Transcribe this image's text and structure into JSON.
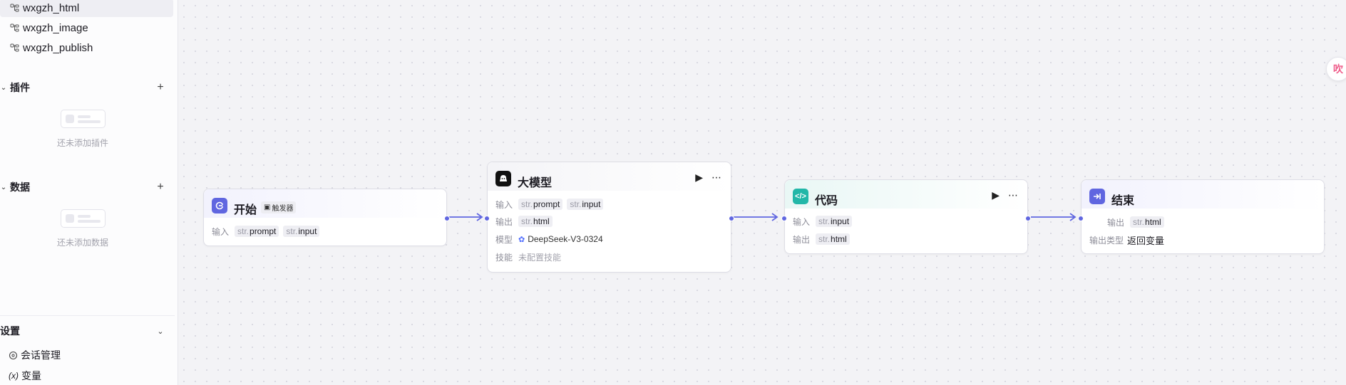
{
  "sidebar": {
    "workflows": [
      {
        "label": "wxgzh_html",
        "active": true
      },
      {
        "label": "wxgzh_image",
        "active": false
      },
      {
        "label": "wxgzh_publish",
        "active": false
      }
    ],
    "plugins": {
      "title": "插件",
      "empty_text": "还未添加插件"
    },
    "data": {
      "title": "数据",
      "empty_text": "还未添加数据"
    },
    "settings": {
      "title": "设置",
      "items": [
        {
          "label": "会话管理",
          "icon": "chat-manage-icon"
        },
        {
          "label": "变量",
          "icon": "variable-icon",
          "icon_text": "(x)"
        }
      ]
    }
  },
  "canvas": {
    "nodes": {
      "start": {
        "title": "开始",
        "badge": "触发器",
        "input_label": "输入",
        "inputs": [
          {
            "type": "str.",
            "name": "prompt"
          },
          {
            "type": "str.",
            "name": "input"
          }
        ],
        "color": "#6066e0"
      },
      "llm": {
        "title": "大模型",
        "input_label": "输入",
        "inputs": [
          {
            "type": "str.",
            "name": "prompt"
          },
          {
            "type": "str.",
            "name": "input"
          }
        ],
        "output_label": "输出",
        "outputs": [
          {
            "type": "str.",
            "name": "html"
          }
        ],
        "model_label": "模型",
        "model_value": "DeepSeek-V3-0324",
        "skill_label": "技能",
        "skill_value": "未配置技能",
        "color": "#111111"
      },
      "code": {
        "title": "代码",
        "input_label": "输入",
        "inputs": [
          {
            "type": "str.",
            "name": "input"
          }
        ],
        "output_label": "输出",
        "outputs": [
          {
            "type": "str.",
            "name": "html"
          }
        ],
        "color": "#22b7a8"
      },
      "end": {
        "title": "结束",
        "output_label": "输出",
        "outputs": [
          {
            "type": "str.",
            "name": "html"
          }
        ],
        "output_type_label": "输出类型",
        "output_type_value": "返回变量",
        "color": "#6066e0"
      }
    },
    "edge_color": "#6066e0",
    "avatar_text": "吹"
  }
}
